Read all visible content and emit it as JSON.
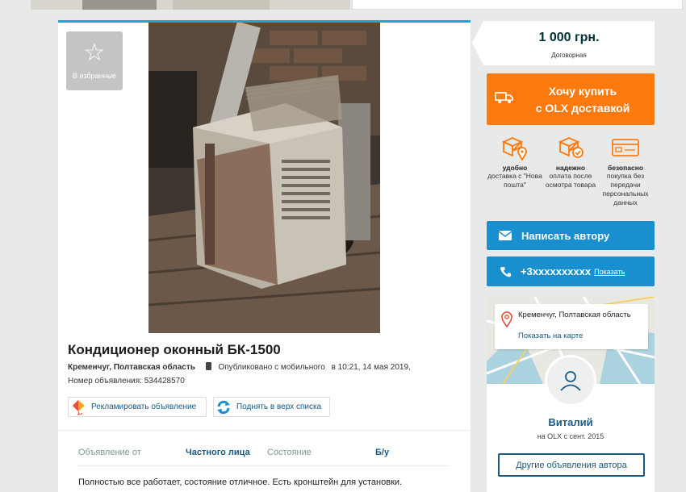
{
  "listing": {
    "favorite_label": "В избранные",
    "title": "Кондиционер оконный БК-1500",
    "city": "Кременчуг, Полтавская область",
    "published": "Опубликовано с мобильного",
    "published_time": "в 10:21, 14 мая 2019,",
    "ad_number": "Номер объявления: 534428570",
    "promote_label": "Рекламировать объявление",
    "raise_label": "Поднять в верх списка",
    "params": {
      "seller_label": "Объявление от",
      "seller_value": "Частного лица",
      "condition_label": "Состояние",
      "condition_value": "Б/у"
    },
    "description": "Полностью все работает, состояние отличное. Есть кронштейн для установки."
  },
  "sidebar": {
    "price": "1 000 грн.",
    "negotiable": "Договорная",
    "buy_line1": "Хочу купить",
    "buy_line2": "с OLX доставкой",
    "features": [
      {
        "title": "удобно",
        "text": "доставка с \"Нова пошта\""
      },
      {
        "title": "надежно",
        "text": "оплата после осмотра товара"
      },
      {
        "title": "безопасно",
        "text": "покупка без передачи персональных данных"
      }
    ],
    "message_label": "Написать автору",
    "phone": "+3xxxxxxxxxx",
    "show_label": "Показать",
    "location": "Кременчуг, Полтавская область",
    "map_link": "Показать на карте",
    "user_name": "Виталий",
    "since": "на OLX с сент. 2015",
    "other_ads": "Другие объявления автора"
  },
  "colors": {
    "accent_blue": "#1a8fd0",
    "accent_orange": "#ff7a0e",
    "link": "#1a5a83"
  }
}
